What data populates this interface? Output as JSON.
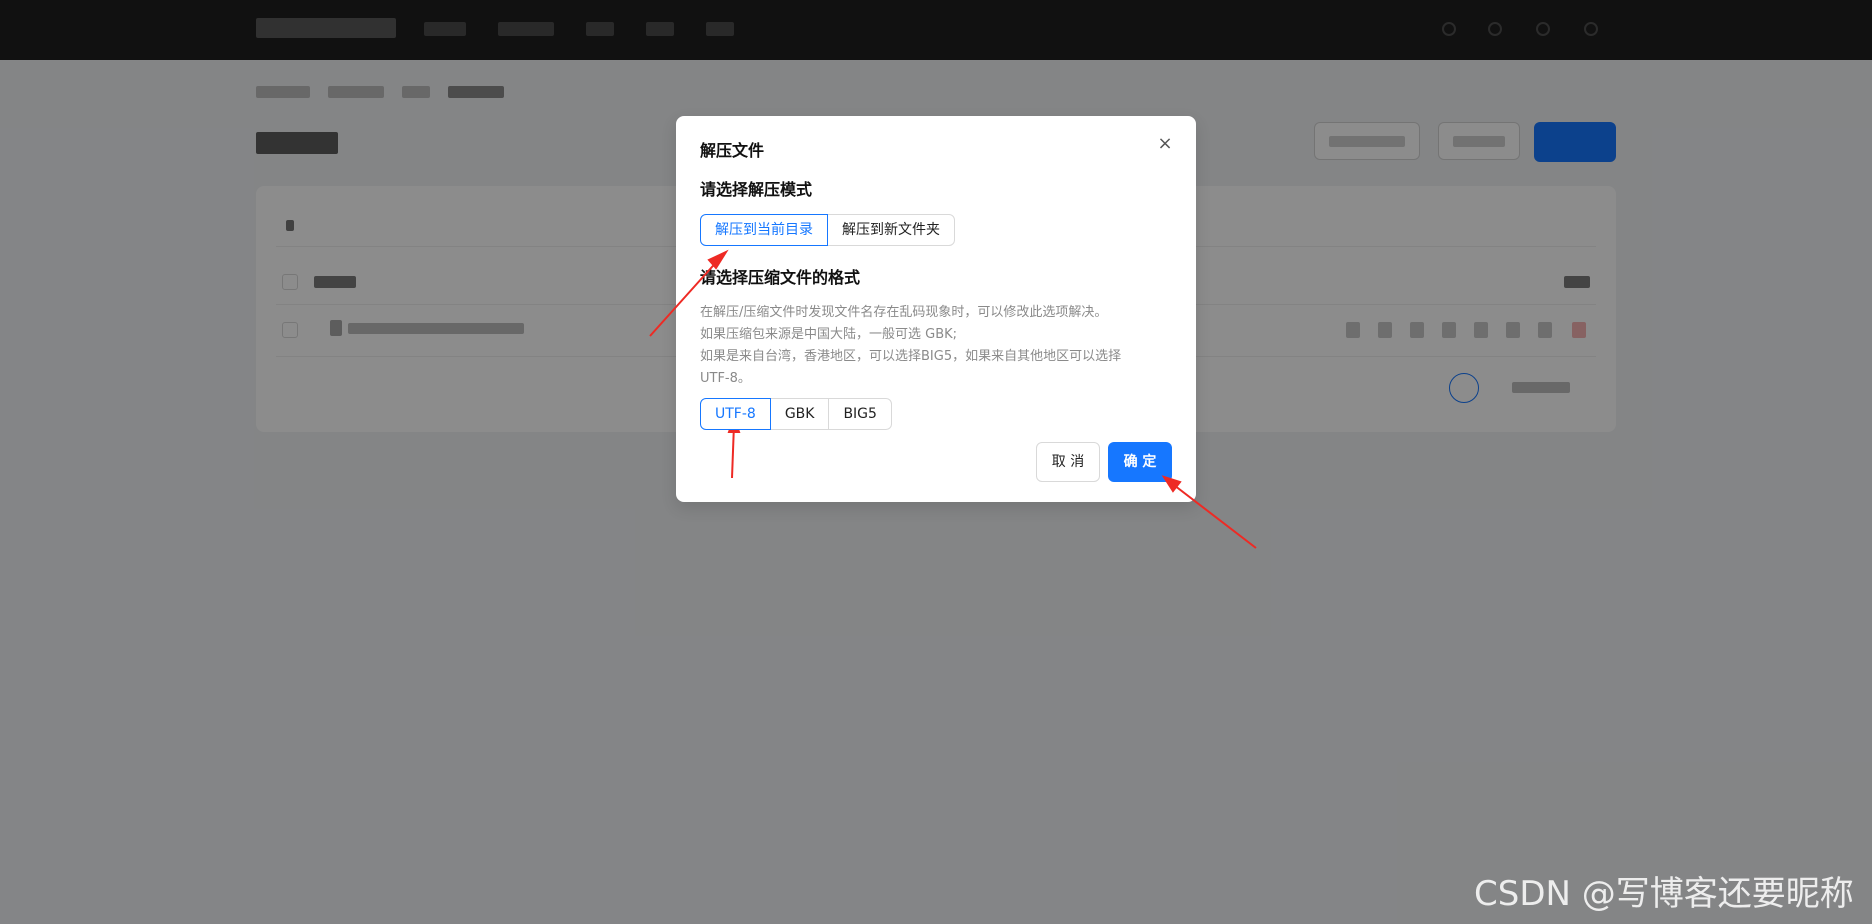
{
  "dialog": {
    "title": "解压文件",
    "close_glyph": "×",
    "mode_label": "请选择解压模式",
    "modes": [
      "解压到当前目录",
      "解压到新文件夹"
    ],
    "selected_mode": "解压到当前目录",
    "format_label": "请选择压缩文件的格式",
    "description": [
      "在解压/压缩文件时发现文件名存在乱码现象时，可以修改此选项解决。",
      "如果压缩包来源是中国大陆，一般可选 GBK;",
      "如果是来自台湾，香港地区，可以选择BIG5，如果来自其他地区可以选择",
      "UTF-8。"
    ],
    "encodings": [
      "UTF-8",
      "GBK",
      "BIG5"
    ],
    "selected_encoding": "UTF-8",
    "cancel_label": "取 消",
    "ok_label": "确 定"
  },
  "watermark": "CSDN @写博客还要昵称",
  "colors": {
    "primary": "#1677ff",
    "annotation_arrow": "#ee2a24",
    "topbar": "#1f1f1f"
  },
  "icons": [
    "close-icon",
    "file-icon",
    "upload-icon"
  ]
}
